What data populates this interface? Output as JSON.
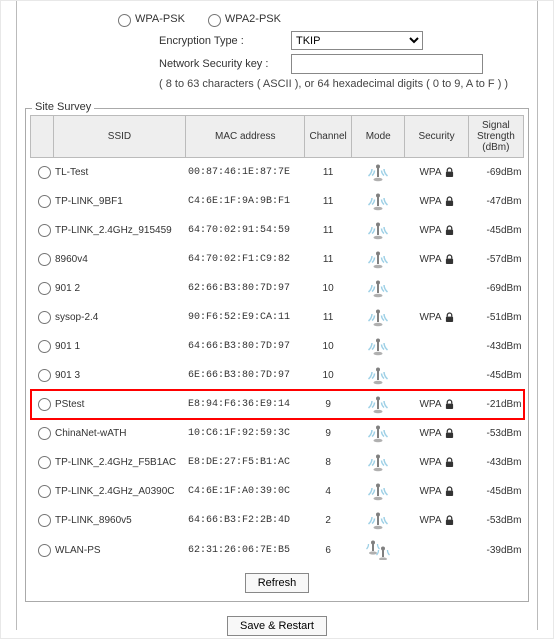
{
  "security": {
    "wpa_psk_label": "WPA-PSK",
    "wpa2_psk_label": "WPA2-PSK",
    "enc_label": "Encryption Type :",
    "enc_value": "TKIP",
    "key_label": "Network Security key :",
    "key_value": "",
    "note": "( 8 to 63 characters ( ASCII ), or 64 hexadecimal digits ( 0 to 9, A to F ) )"
  },
  "survey": {
    "legend": "Site Survey",
    "headers": {
      "radio": "",
      "ssid": "SSID",
      "mac": "MAC address",
      "channel": "Channel",
      "mode": "Mode",
      "security": "Security",
      "rssi": "Signal Strength (dBm)"
    },
    "rows": [
      {
        "ssid": "TL-Test",
        "mac": "00:87:46:1E:87:7E",
        "channel": "11",
        "security": "WPA",
        "rssi": "-69dBm",
        "locked": true,
        "mode": "wifi",
        "highlight": false
      },
      {
        "ssid": "TP-LINK_9BF1",
        "mac": "C4:6E:1F:9A:9B:F1",
        "channel": "11",
        "security": "WPA",
        "rssi": "-47dBm",
        "locked": true,
        "mode": "wifi",
        "highlight": false
      },
      {
        "ssid": "TP-LINK_2.4GHz_915459",
        "mac": "64:70:02:91:54:59",
        "channel": "11",
        "security": "WPA",
        "rssi": "-45dBm",
        "locked": true,
        "mode": "wifi",
        "highlight": false
      },
      {
        "ssid": "8960v4",
        "mac": "64:70:02:F1:C9:82",
        "channel": "11",
        "security": "WPA",
        "rssi": "-57dBm",
        "locked": true,
        "mode": "wifi",
        "highlight": false
      },
      {
        "ssid": "901 2",
        "mac": "62:66:B3:80:7D:97",
        "channel": "10",
        "security": "",
        "rssi": "-69dBm",
        "locked": false,
        "mode": "wifi",
        "highlight": false
      },
      {
        "ssid": "sysop-2.4",
        "mac": "90:F6:52:E9:CA:11",
        "channel": "11",
        "security": "WPA",
        "rssi": "-51dBm",
        "locked": true,
        "mode": "wifi",
        "highlight": false
      },
      {
        "ssid": "901 1",
        "mac": "64:66:B3:80:7D:97",
        "channel": "10",
        "security": "",
        "rssi": "-43dBm",
        "locked": false,
        "mode": "wifi",
        "highlight": false
      },
      {
        "ssid": "901 3",
        "mac": "6E:66:B3:80:7D:97",
        "channel": "10",
        "security": "",
        "rssi": "-45dBm",
        "locked": false,
        "mode": "wifi",
        "highlight": false
      },
      {
        "ssid": "PStest",
        "mac": "E8:94:F6:36:E9:14",
        "channel": "9",
        "security": "WPA",
        "rssi": "-21dBm",
        "locked": true,
        "mode": "wifi",
        "highlight": true
      },
      {
        "ssid": "ChinaNet-wATH",
        "mac": "10:C6:1F:92:59:3C",
        "channel": "9",
        "security": "WPA",
        "rssi": "-53dBm",
        "locked": true,
        "mode": "wifi",
        "highlight": false
      },
      {
        "ssid": "TP-LINK_2.4GHz_F5B1AC",
        "mac": "E8:DE:27:F5:B1:AC",
        "channel": "8",
        "security": "WPA",
        "rssi": "-43dBm",
        "locked": true,
        "mode": "wifi",
        "highlight": false
      },
      {
        "ssid": "TP-LINK_2.4GHz_A0390C",
        "mac": "C4:6E:1F:A0:39:0C",
        "channel": "4",
        "security": "WPA",
        "rssi": "-45dBm",
        "locked": true,
        "mode": "wifi",
        "highlight": false
      },
      {
        "ssid": "TP-LINK_8960v5",
        "mac": "64:66:B3:F2:2B:4D",
        "channel": "2",
        "security": "WPA",
        "rssi": "-53dBm",
        "locked": true,
        "mode": "wifi",
        "highlight": false
      },
      {
        "ssid": "WLAN-PS",
        "mac": "62:31:26:06:7E:B5",
        "channel": "6",
        "security": "",
        "rssi": "-39dBm",
        "locked": false,
        "mode": "adhoc",
        "highlight": false
      }
    ],
    "refresh_label": "Refresh"
  },
  "footer": {
    "save_label": "Save & Restart"
  }
}
